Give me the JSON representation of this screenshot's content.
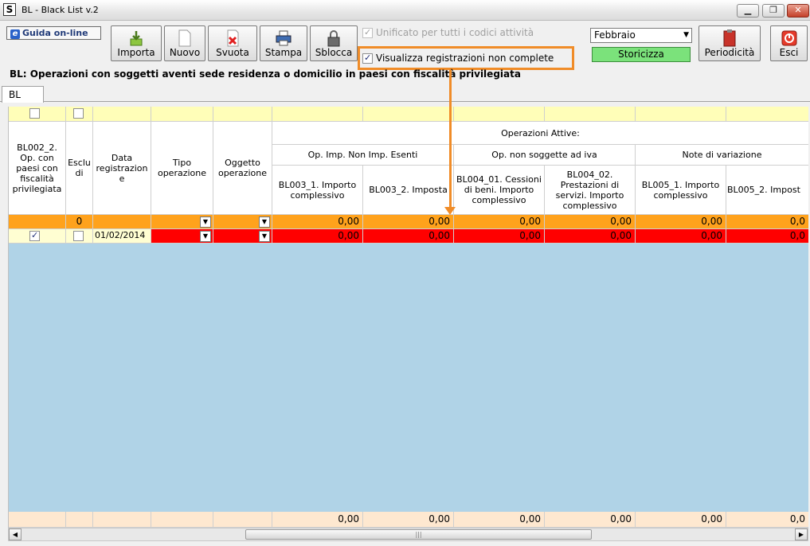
{
  "window": {
    "title": "BL - Black List v.2",
    "app_icon": "S",
    "minimize": "▁",
    "restore": "❐",
    "close": "✕"
  },
  "toolbar": {
    "guida_label": "Guida on-line",
    "buttons": [
      {
        "label": "Importa",
        "icon": "import-icon"
      },
      {
        "label": "Nuovo",
        "icon": "new-document-icon"
      },
      {
        "label": "Svuota",
        "icon": "clear-icon"
      },
      {
        "label": "Stampa",
        "icon": "printer-icon"
      },
      {
        "label": "Sblocca",
        "icon": "lock-icon"
      },
      {
        "label": "Periodicità",
        "icon": "book-icon"
      },
      {
        "label": "Esci",
        "icon": "exit-icon"
      }
    ],
    "unificato_label": "Unificato per tutti i codici attività",
    "visualizza_label": "Visualizza registrazioni non complete",
    "month_value": "Febbraio",
    "storicizza_label": "Storicizza"
  },
  "heading": "BL: Operazioni con soggetti aventi sede residenza o domicilio in paesi con fiscalità privilegiata",
  "tab_label": "BL",
  "grid": {
    "header_col1": "BL002_2. Op. con paesi con fiscalità privilegiata",
    "header_col2": "Esclu di",
    "header_col3": "Data registrazion e",
    "header_col4": "Tipo operazione",
    "header_col5": "Oggetto operazione",
    "group_top": "Operazioni Attive:",
    "group_a": "Op. Imp. Non Imp. Esenti",
    "group_b": "Op. non soggette ad iva",
    "group_c": "Note di variazione",
    "sub": [
      "BL003_1. Importo complessivo",
      "BL003_2. Imposta",
      "BL004_01. Cessioni di beni. Importo complessivo",
      "BL004_02. Prestazioni di servizi. Importo complessivo",
      "BL005_1. Importo complessivo",
      "BL005_2. Impost"
    ],
    "total_row": {
      "count": "0",
      "values": [
        "0,00",
        "0,00",
        "0,00",
        "0,00",
        "0,00",
        "0,0"
      ]
    },
    "data_row": {
      "date": "01/02/2014",
      "values": [
        "0,00",
        "0,00",
        "0,00",
        "0,00",
        "0,00",
        "0,0"
      ]
    },
    "footer_values": [
      "0,00",
      "0,00",
      "0,00",
      "0,00",
      "0,00",
      "0,0"
    ]
  },
  "colors": {
    "orange_row": "#ffa21c",
    "red_row": "#ff0000",
    "grid_bg": "#b0d3e7",
    "highlight": "#f08c28"
  }
}
